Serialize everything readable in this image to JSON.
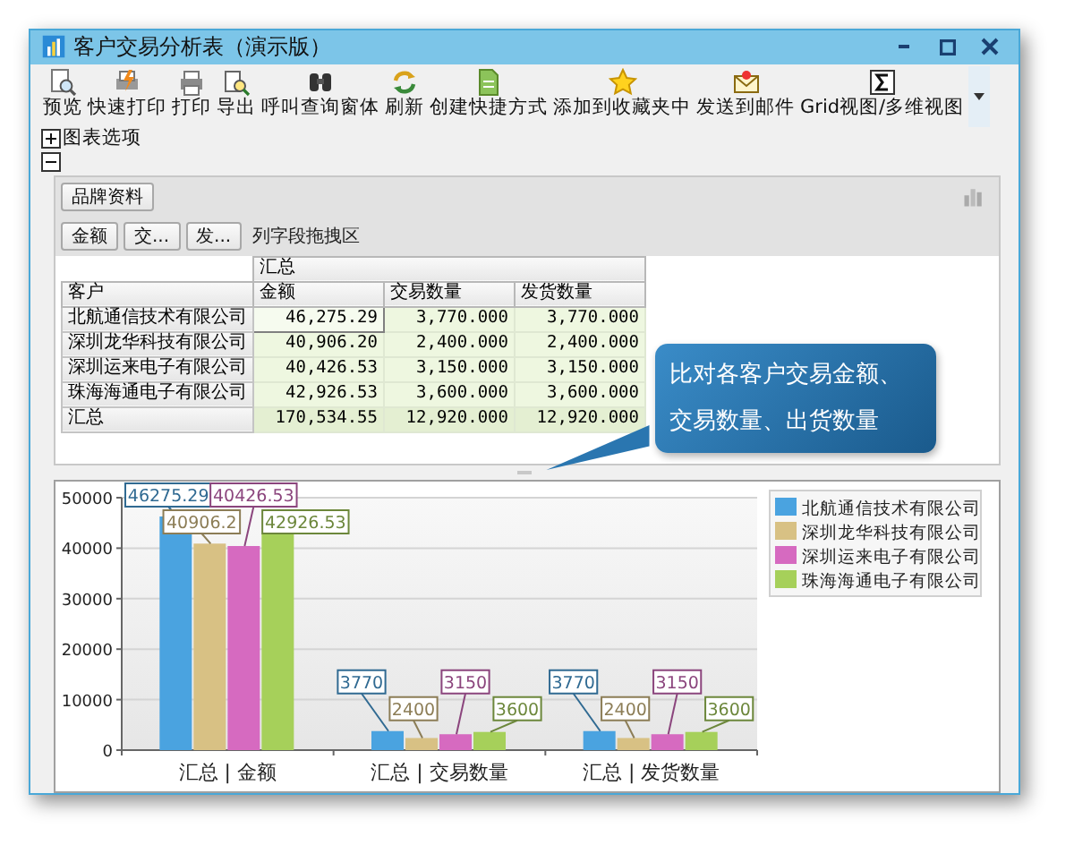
{
  "window": {
    "title": "客户交易分析表（演示版）"
  },
  "toolbar": {
    "items": [
      {
        "label": "预览"
      },
      {
        "label": "快速打印"
      },
      {
        "label": "打印"
      },
      {
        "label": "导出"
      },
      {
        "label": "呼叫查询窗体"
      },
      {
        "label": "刷新"
      },
      {
        "label": "创建快捷方式"
      },
      {
        "label": "添加到收藏夹中"
      },
      {
        "label": "发送到邮件"
      },
      {
        "label": "Grid视图/多维视图"
      }
    ]
  },
  "chart_options": {
    "label": "图表选项",
    "expanded": false
  },
  "pivot_section": {
    "expanded": true
  },
  "pivot": {
    "filter_fields": [
      {
        "label": "品牌资料"
      }
    ],
    "data_fields": [
      {
        "label": "金额"
      },
      {
        "label": "交..."
      },
      {
        "label": "发..."
      }
    ],
    "column_area": "列字段拖拽区",
    "row_field": "客户",
    "column_group": "汇总",
    "columns": [
      "金额",
      "交易数量",
      "发货数量"
    ],
    "rows": [
      {
        "kind": "data",
        "label": "北航通信技术有限公司",
        "cells": [
          {
            "text": "46,275.29",
            "selected": true
          },
          {
            "text": "3,770.000",
            "selected": false
          },
          {
            "text": "3,770.000",
            "selected": false
          }
        ]
      },
      {
        "kind": "data",
        "label": "深圳龙华科技有限公司",
        "cells": [
          {
            "text": "40,906.20",
            "selected": false
          },
          {
            "text": "2,400.000",
            "selected": false
          },
          {
            "text": "2,400.000",
            "selected": false
          }
        ]
      },
      {
        "kind": "data",
        "label": "深圳运来电子有限公司",
        "cells": [
          {
            "text": "40,426.53",
            "selected": false
          },
          {
            "text": "3,150.000",
            "selected": false
          },
          {
            "text": "3,150.000",
            "selected": false
          }
        ]
      },
      {
        "kind": "data",
        "label": "珠海海通电子有限公司",
        "cells": [
          {
            "text": "42,926.53",
            "selected": false
          },
          {
            "text": "3,600.000",
            "selected": false
          },
          {
            "text": "3,600.000",
            "selected": false
          }
        ]
      },
      {
        "kind": "total",
        "label": "汇总",
        "cells": [
          {
            "text": "170,534.55",
            "selected": false
          },
          {
            "text": "12,920.000",
            "selected": false
          },
          {
            "text": "12,920.000",
            "selected": false
          }
        ]
      }
    ]
  },
  "callout": {
    "text": "比对各客户交易金额、交易数量、出货数量"
  },
  "chart": {
    "chart_data": {
      "type": "bar",
      "categories": [
        "汇总 | 金额",
        "汇总 | 交易数量",
        "汇总 | 发货数量"
      ],
      "series": [
        {
          "name": "北航通信技术有限公司",
          "color": "#4aa3e0",
          "values": [
            46275.29,
            3770,
            3770
          ]
        },
        {
          "name": "深圳龙华科技有限公司",
          "color": "#d8c184",
          "values": [
            40906.2,
            2400,
            2400
          ]
        },
        {
          "name": "深圳运来电子有限公司",
          "color": "#d66ac0",
          "values": [
            40426.53,
            3150,
            3150
          ]
        },
        {
          "name": "珠海海通电子有限公司",
          "color": "#a6d05a",
          "values": [
            42926.53,
            3600,
            3600
          ]
        }
      ],
      "grid": true,
      "legend": true,
      "ylim": [
        0,
        50000
      ],
      "yticks": [
        0,
        10000,
        20000,
        30000,
        40000,
        50000
      ],
      "data_labels": true
    }
  }
}
